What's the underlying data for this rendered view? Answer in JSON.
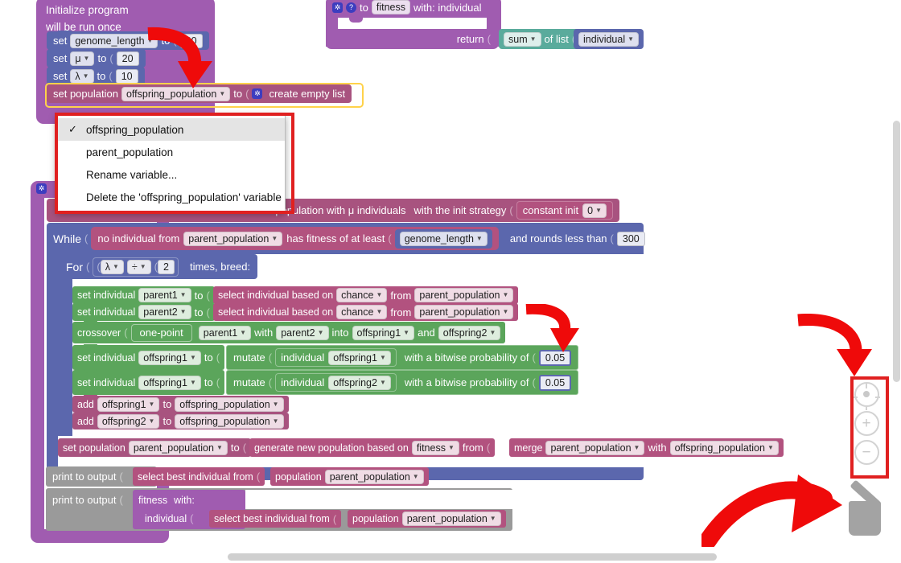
{
  "app": {
    "background": "#ffffff",
    "accent_red": "#e02020"
  },
  "init_hat": {
    "line1": "Initialize program",
    "line2": "will be run once",
    "statements": [
      {
        "prefix": "set",
        "variable": "genome_length",
        "to": "to",
        "value": "20"
      },
      {
        "prefix": "set",
        "variable": "μ",
        "to": "to",
        "value": "20"
      },
      {
        "prefix": "set",
        "variable": "λ",
        "to": "to",
        "value": "10"
      }
    ],
    "set_population": {
      "prefix": "set population",
      "variable": "offspring_population",
      "to": "to",
      "value_icon": "gear-icon",
      "value_label": "create empty list"
    }
  },
  "fitness_def": {
    "gear_icon": "gear-icon",
    "help_icon": "help-icon",
    "to": "to",
    "name": "fitness",
    "params": "with: individual",
    "return_label": "return",
    "operator": "sum",
    "of_list": "of list",
    "operand": "individual"
  },
  "variable_menu": {
    "items": [
      {
        "label": "offspring_population",
        "checked": true
      },
      {
        "label": "parent_population",
        "checked": false
      },
      {
        "label": "Rename variable...",
        "checked": false
      },
      {
        "label": "Delete the 'offspring_population' variable",
        "checked": false
      }
    ],
    "check_glyph": "✓"
  },
  "algorithm": {
    "gear_icon": "gear-icon",
    "init_pop": {
      "text_a": "init population with μ individuals",
      "text_b": "with the init strategy",
      "strategy_label": "constant init",
      "strategy_value": "0"
    },
    "while": {
      "keyword": "While",
      "condition_a": "no individual from",
      "condition_var": "parent_population",
      "condition_b": "has fitness of at least",
      "threshold_var": "genome_length",
      "rounds_label": "and rounds less than",
      "rounds_value": "300"
    },
    "for": {
      "keyword": "For",
      "operand_a": "λ",
      "operator": "÷",
      "operand_b": "2",
      "suffix": "times, breed:"
    },
    "breed_body": [
      {
        "type": "set-individual",
        "prefix": "set individual",
        "variable": "parent1",
        "to": "to",
        "value_a": "select individual based on",
        "value_mode": "chance",
        "value_b": "from",
        "value_var": "parent_population"
      },
      {
        "type": "set-individual",
        "prefix": "set individual",
        "variable": "parent2",
        "to": "to",
        "value_a": "select individual based on",
        "value_mode": "chance",
        "value_b": "from",
        "value_var": "parent_population"
      }
    ],
    "crossover": {
      "keyword": "crossover",
      "method": "one-point",
      "parent_a": "parent1",
      "with": "with",
      "parent_b": "parent2",
      "into": "into",
      "child_a": "offspring1",
      "and": "and",
      "child_b": "offspring2"
    },
    "mutations": [
      {
        "prefix": "set individual",
        "variable": "offspring1",
        "to": "to",
        "verb": "mutate",
        "arg_label": "individual",
        "arg_var": "offspring1",
        "prob_label": "with a bitwise probability of",
        "prob_value": "0.05"
      },
      {
        "prefix": "set individual",
        "variable": "offspring1",
        "to": "to",
        "verb": "mutate",
        "arg_label": "individual",
        "arg_var": "offspring2",
        "prob_label": "with a bitwise probability of",
        "prob_value": "0.05"
      }
    ],
    "adds": [
      {
        "verb": "add",
        "item": "offspring1",
        "to": "to",
        "target": "offspring_population"
      },
      {
        "verb": "add",
        "item": "offspring2",
        "to": "to",
        "target": "offspring_population"
      }
    ],
    "set_population": {
      "prefix": "set population",
      "variable": "parent_population",
      "to": "to",
      "gen_label": "generate new population based on",
      "gen_criterion": "fitness",
      "gen_from": "from",
      "merge_label": "merge",
      "merge_a": "parent_population",
      "merge_with": "with",
      "merge_b": "offspring_population"
    },
    "prints": [
      {
        "keyword": "print to output",
        "value_a": "select best individual from",
        "pop_label": "population",
        "pop_var": "parent_population"
      },
      {
        "keyword": "print to output",
        "call_name": "fitness",
        "call_with": "with:",
        "arg_label": "individual",
        "value_a": "select best individual from",
        "pop_label": "population",
        "pop_var": "parent_population"
      }
    ]
  },
  "zoom_controls": {
    "center_icon": "center-target-icon",
    "zoom_in_icon": "plus-icon",
    "zoom_out_icon": "minus-icon",
    "zoom_in_glyph": "+",
    "zoom_out_glyph": "−"
  },
  "trash": {
    "icon": "trash-can-icon"
  },
  "scrollbars": {
    "horizontal": "horizontal-scrollbar",
    "vertical": "vertical-scrollbar"
  }
}
